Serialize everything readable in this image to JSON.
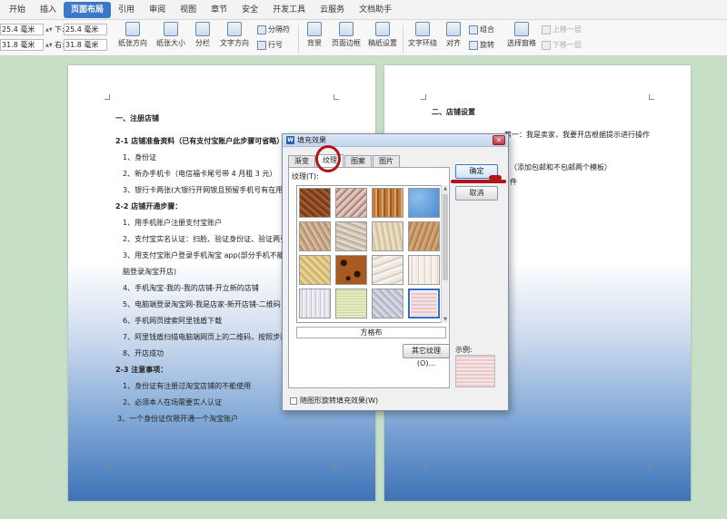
{
  "ribbon": {
    "tabs": [
      "开始",
      "插入",
      "页面布局",
      "引用",
      "审阅",
      "视图",
      "章节",
      "安全",
      "开发工具",
      "云服务",
      "文档助手"
    ],
    "active_tab": "页面布局"
  },
  "toolbar": {
    "margin_top_label": "上:",
    "margin_top_value": "25.4 毫米",
    "margin_bottom_label": "下:",
    "margin_bottom_value": "25.4 毫米",
    "margin_left_label": "左:",
    "margin_left_value": "31.8 毫米",
    "margin_right_label": "右:",
    "margin_right_value": "31.8 毫米",
    "orientation": "纸张方向",
    "paper_size": "纸张大小",
    "columns": "分栏",
    "text_direction": "文字方向",
    "breaks": "分隔符",
    "line_numbers": "行号",
    "background": "背景",
    "page_border": "页面边框",
    "paper_settings": "稿纸设置",
    "text_wrap": "文字环绕",
    "align": "对齐",
    "group": "组合",
    "rotate": "旋转",
    "selection_pane": "选择窗格",
    "bring_forward": "上移一层",
    "send_backward": "下移一层"
  },
  "doc_left": {
    "lines": [
      "一、注册店铺",
      "2-1 店铺准备资料（已有支付宝账户此步骤可省略）",
      "1、身份证",
      "2、新办手机卡（电信福卡尾号带 4 月租 3 元）",
      "3、银行卡两张(大银行开网银且预留手机号有在用",
      "2-2 店铺开通步骤：",
      "1、用手机账户注册支付宝账户",
      "2、支付宝实名认证：扫脸、验证身份证、验证两张",
      "3、用支付宝账户登录手机淘宝 app(部分手机不能登",
      "脑登录淘宝开店)",
      "4、手机淘宝-我的-我的店铺-开立新的店铺",
      "5、电脑端登录淘宝网-我是店家-新开店铺-二维码",
      "6、手机网页搜索阿里钱盾下载",
      "7、阿里钱盾扫描电脑端网页上的二维码，按照步骤",
      "8、开店成功",
      "2-3 注意事项：",
      "1、身份证有注册过淘宝店铺的不能使用",
      "2、必须本人在场需要实人认证",
      "3、一个身份证仅限开通一个淘宝账户"
    ]
  },
  "doc_right": {
    "lines": [
      "二、店铺设置",
      "第一：我是卖家，我要开店根据提示进行操作",
      "（添加包邮和不包邮两个模板）",
      "件"
    ]
  },
  "dialog": {
    "title": "填充效果",
    "close": "✕",
    "tabs": [
      "渐变",
      "纹理",
      "图案",
      "图片"
    ],
    "active_tab": "纹理",
    "texture_label": "纹理(T):",
    "selected_name": "方格布",
    "selected_index": 15,
    "other_texture_button": "其它纹理(O)...",
    "ok_button": "确定",
    "cancel_button": "取消",
    "sample_label": "示例:",
    "rotate_checkbox": "随图形旋转填充效果(W)",
    "rotate_checked": false
  },
  "colors": {
    "accent": "#3a78c9",
    "annotation": "#b3141a",
    "workspace": "#c6dfc6"
  }
}
